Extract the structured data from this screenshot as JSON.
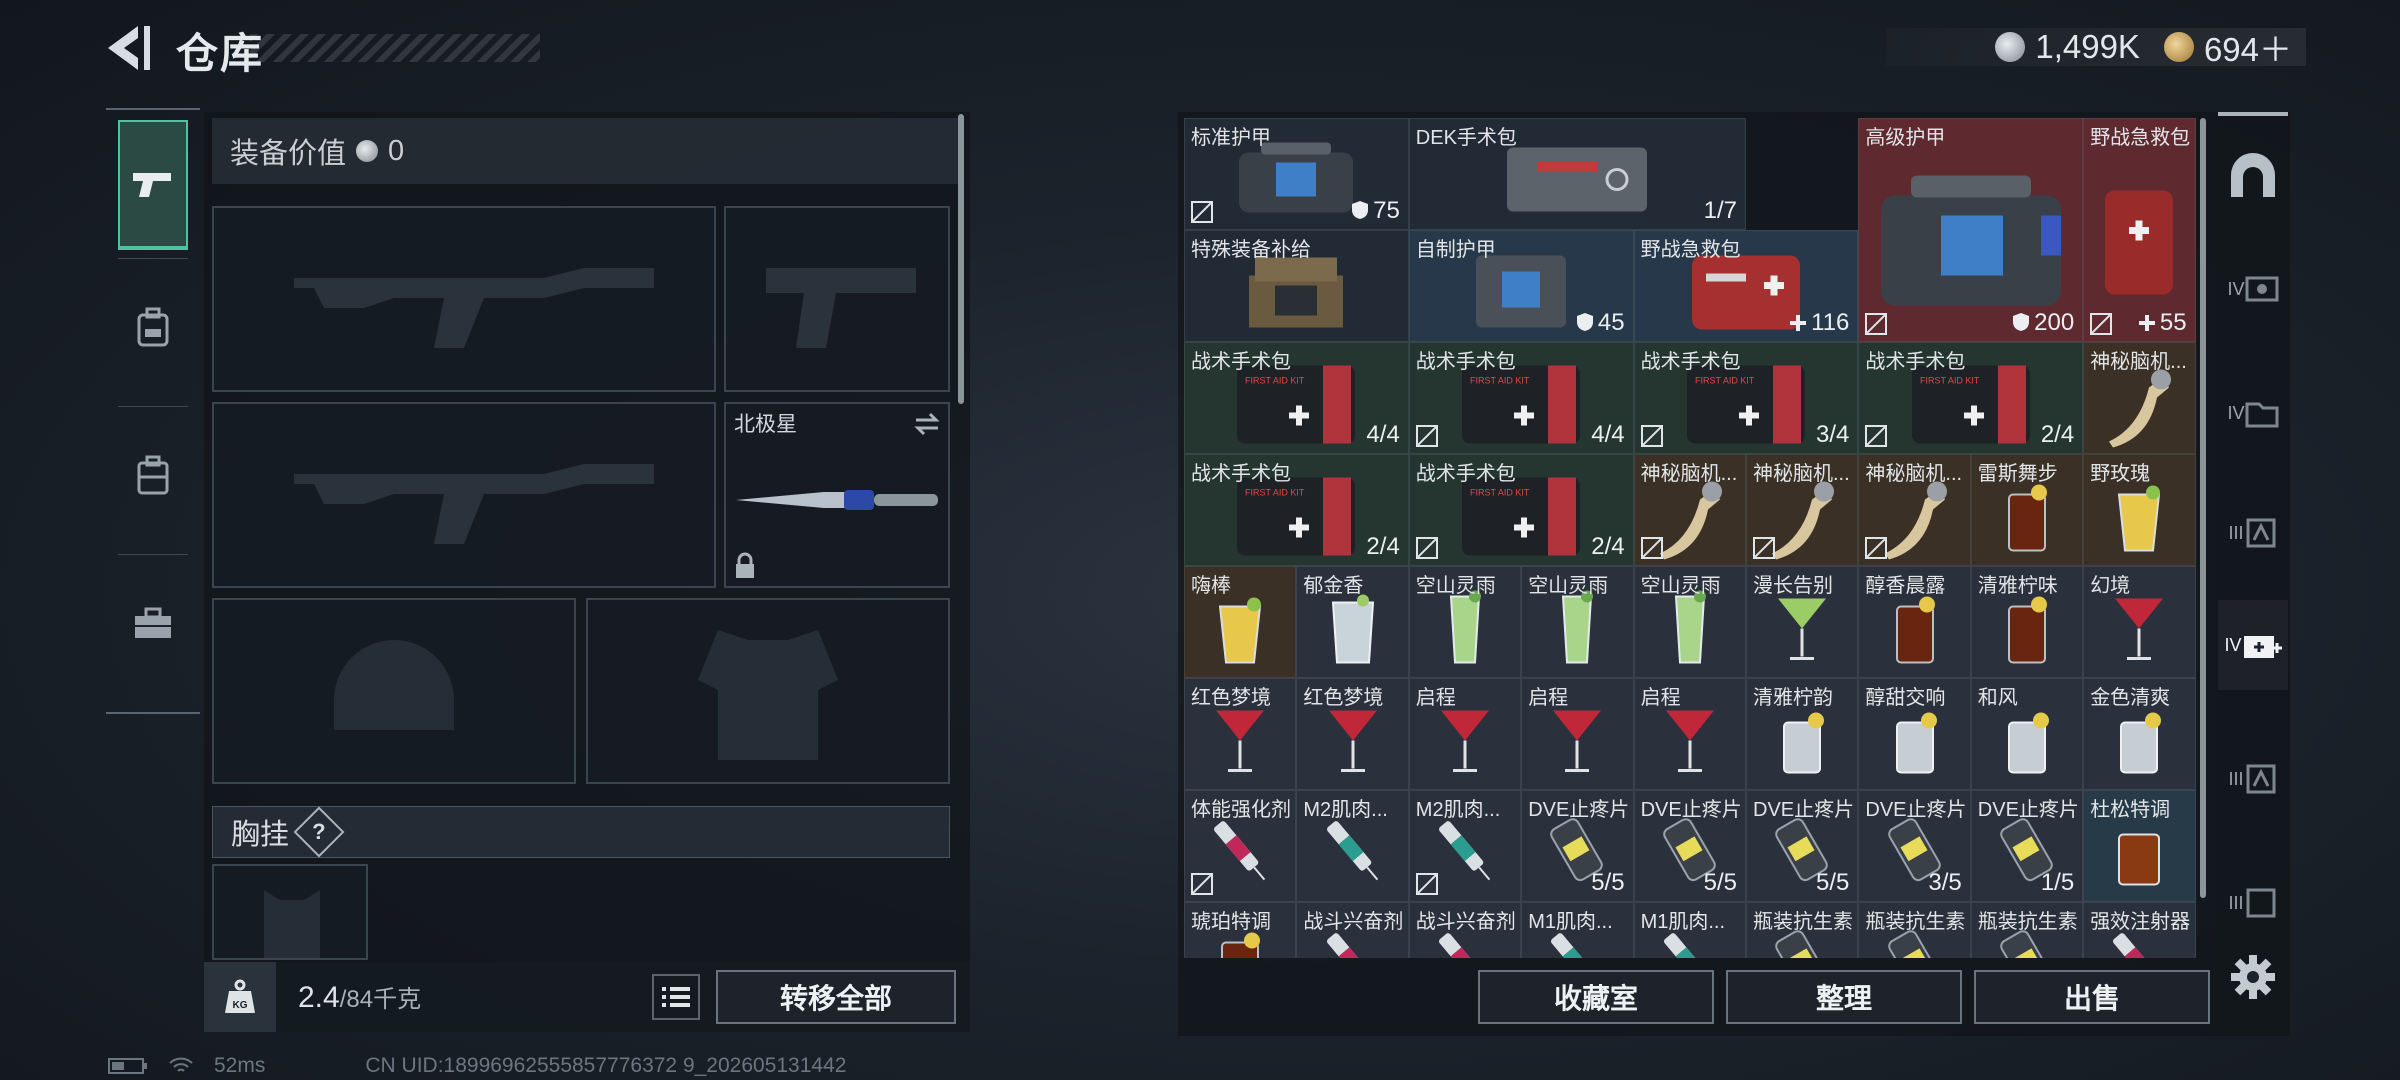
{
  "header": {
    "title": "仓库",
    "currencies": [
      {
        "icon": "silver-coin-icon",
        "value": "1,499K"
      },
      {
        "icon": "gold-coin-icon",
        "value": "694＋"
      }
    ]
  },
  "loadout": {
    "equipment_value_label": "装备价值",
    "equipment_value": "0",
    "melee_name": "北极星",
    "chest_rig_label": "胸挂",
    "help_badge": "?"
  },
  "bottom_left": {
    "weight_value": "2.4",
    "weight_capacity": "/84千克",
    "kg_badge": "KG",
    "transfer_all": "转移全部"
  },
  "status": {
    "ping": "52ms",
    "uid": "CN UID:18996962555857776372 9_202605131442"
  },
  "warehouse": {
    "items": [
      {
        "name": "标准护甲",
        "qty": "75",
        "qty_prefix": "shield",
        "locked": true
      },
      {
        "name": "DEK手术包",
        "qty": "1/7"
      },
      {
        "name": "高级护甲",
        "qty": "200",
        "qty_prefix": "shield",
        "locked": true
      },
      {
        "name": "野战急救包",
        "qty": "55",
        "qty_prefix": "plus",
        "locked": true
      },
      {
        "name": "特殊装备补给"
      },
      {
        "name": "自制护甲",
        "qty": "45",
        "qty_prefix": "shield"
      },
      {
        "name": "野战急救包",
        "qty": "116",
        "qty_prefix": "plus"
      },
      {
        "name": "战术手术包",
        "qty": "4/4"
      },
      {
        "name": "战术手术包",
        "qty": "4/4",
        "locked": true
      },
      {
        "name": "战术手术包",
        "qty": "3/4",
        "locked": true
      },
      {
        "name": "战术手术包",
        "qty": "2/4",
        "locked": true
      },
      {
        "name": "神秘脑机..."
      },
      {
        "name": "战术手术包",
        "qty": "2/4"
      },
      {
        "name": "战术手术包",
        "qty": "2/4",
        "locked": true
      },
      {
        "name": "神秘脑机...",
        "locked": true
      },
      {
        "name": "神秘脑机...",
        "locked": true
      },
      {
        "name": "神秘脑机...",
        "locked": true
      },
      {
        "name": "雷斯舞步"
      },
      {
        "name": "野玫瑰"
      },
      {
        "name": "嗨棒"
      },
      {
        "name": "郁金香"
      },
      {
        "name": "空山灵雨"
      },
      {
        "name": "空山灵雨"
      },
      {
        "name": "空山灵雨"
      },
      {
        "name": "漫长告别"
      },
      {
        "name": "醇香晨露"
      },
      {
        "name": "清雅柠味"
      },
      {
        "name": "幻境"
      },
      {
        "name": "红色梦境"
      },
      {
        "name": "红色梦境"
      },
      {
        "name": "启程"
      },
      {
        "name": "启程"
      },
      {
        "name": "启程"
      },
      {
        "name": "清雅柠韵"
      },
      {
        "name": "醇甜交响"
      },
      {
        "name": "和风"
      },
      {
        "name": "金色清爽"
      },
      {
        "name": "体能强化剂",
        "locked": true
      },
      {
        "name": "M2肌肉..."
      },
      {
        "name": "M2肌肉...",
        "locked": true
      },
      {
        "name": "DVE止疼片",
        "qty": "5/5"
      },
      {
        "name": "DVE止疼片",
        "qty": "5/5"
      },
      {
        "name": "DVE止疼片",
        "qty": "5/5"
      },
      {
        "name": "DVE止疼片",
        "qty": "3/5"
      },
      {
        "name": "DVE止疼片",
        "qty": "1/5"
      },
      {
        "name": "杜松特调"
      },
      {
        "name": "琥珀特调"
      },
      {
        "name": "战斗兴奋剂"
      },
      {
        "name": "战斗兴奋剂"
      },
      {
        "name": "M1肌肉..."
      },
      {
        "name": "M1肌肉..."
      },
      {
        "name": "瓶装抗生素"
      },
      {
        "name": "瓶装抗生素"
      },
      {
        "name": "瓶装抗生素"
      },
      {
        "name": "强效注射器"
      }
    ]
  },
  "actions": {
    "collection": "收藏室",
    "organize": "整理",
    "sell": "出售"
  },
  "rail": [
    "IV",
    "IV",
    "III",
    "IV",
    "III",
    "III"
  ],
  "colors": {
    "accent_green": "#4fc3a1",
    "rare_red": "#6b2a2e",
    "epic_green": "#263a34",
    "gold_brown": "#3b3128"
  }
}
